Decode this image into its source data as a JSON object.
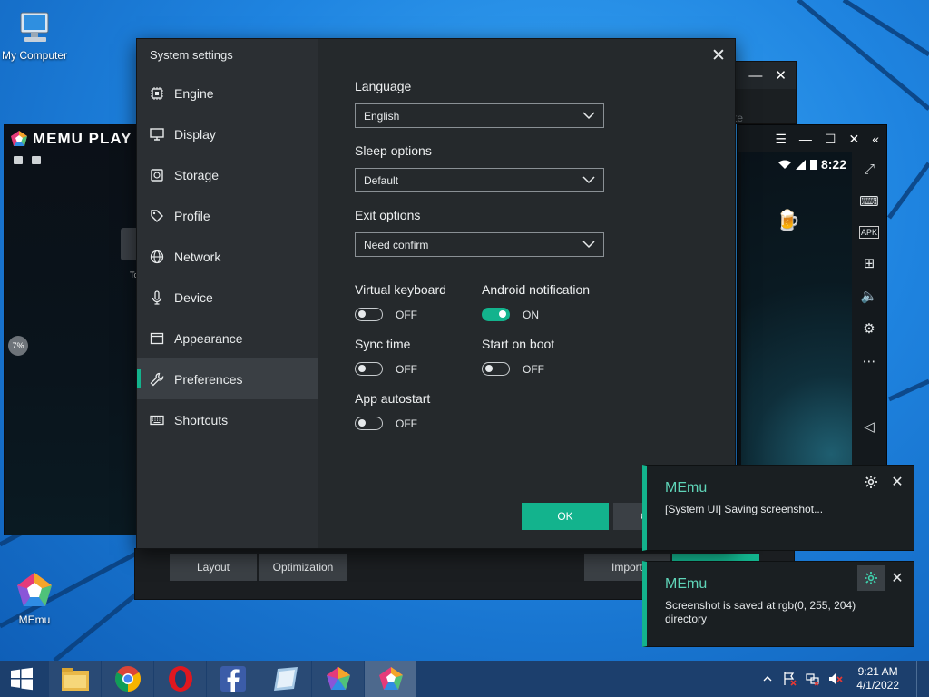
{
  "desktop": {
    "icons": [
      {
        "label": "My Computer",
        "icon": "computer-icon"
      },
      {
        "label": "MEmu",
        "icon": "memu-icon"
      }
    ]
  },
  "memu_main": {
    "logo": "MEMU PLAY",
    "tile_label": "To",
    "badge": "7%"
  },
  "behind_window": {
    "ghost_text": "te",
    "controls": [
      "—",
      "✕"
    ]
  },
  "android": {
    "time": "8:22",
    "title_controls": [
      "☰",
      "—",
      "☐",
      "✕",
      "«"
    ]
  },
  "bottom_strip": {
    "layout_label": "Layout",
    "optimization_label": "Optimization",
    "import_label": "Import"
  },
  "settings": {
    "title": "System settings",
    "close": "✕",
    "nav": [
      {
        "id": "engine",
        "label": "Engine",
        "icon": "chip-icon"
      },
      {
        "id": "display",
        "label": "Display",
        "icon": "monitor-icon"
      },
      {
        "id": "storage",
        "label": "Storage",
        "icon": "disk-icon"
      },
      {
        "id": "profile",
        "label": "Profile",
        "icon": "tag-icon"
      },
      {
        "id": "network",
        "label": "Network",
        "icon": "globe-icon"
      },
      {
        "id": "device",
        "label": "Device",
        "icon": "mic-icon"
      },
      {
        "id": "appearance",
        "label": "Appearance",
        "icon": "window-icon"
      },
      {
        "id": "preferences",
        "label": "Preferences",
        "icon": "wrench-icon",
        "active": true
      },
      {
        "id": "shortcuts",
        "label": "Shortcuts",
        "icon": "keyboard-icon"
      }
    ],
    "language": {
      "label": "Language",
      "value": "English"
    },
    "sleep": {
      "label": "Sleep options",
      "value": "Default"
    },
    "exit": {
      "label": "Exit options",
      "value": "Need confirm"
    },
    "toggles": {
      "virtual_keyboard": {
        "label": "Virtual keyboard",
        "state": "OFF"
      },
      "android_notification": {
        "label": "Android notification",
        "state": "ON"
      },
      "sync_time": {
        "label": "Sync time",
        "state": "OFF"
      },
      "start_on_boot": {
        "label": "Start on boot",
        "state": "OFF"
      },
      "app_autostart": {
        "label": "App autostart",
        "state": "OFF"
      }
    },
    "ok_label": "OK",
    "cancel_label": "Cancel"
  },
  "notifications": [
    {
      "title": "MEmu",
      "body": "[System UI] Saving screenshot..."
    },
    {
      "title": "MEmu",
      "body": "Screenshot is saved at rgb(0, 255, 204) directory"
    }
  ],
  "taskbar": {
    "apps": [
      "file-explorer-icon",
      "chrome-icon",
      "opera-icon",
      "facebook-icon",
      "notepad-icon",
      "memu-multi-icon",
      "memu-icon"
    ],
    "time": "9:21 AM",
    "date": "4/1/2022"
  },
  "colors": {
    "accent": "#13b38d",
    "dialog_bg": "#25292c",
    "sidebar_bg": "#2b2f33",
    "notif_title": "#5fd4b8",
    "taskbar": "#1c3f6d"
  }
}
